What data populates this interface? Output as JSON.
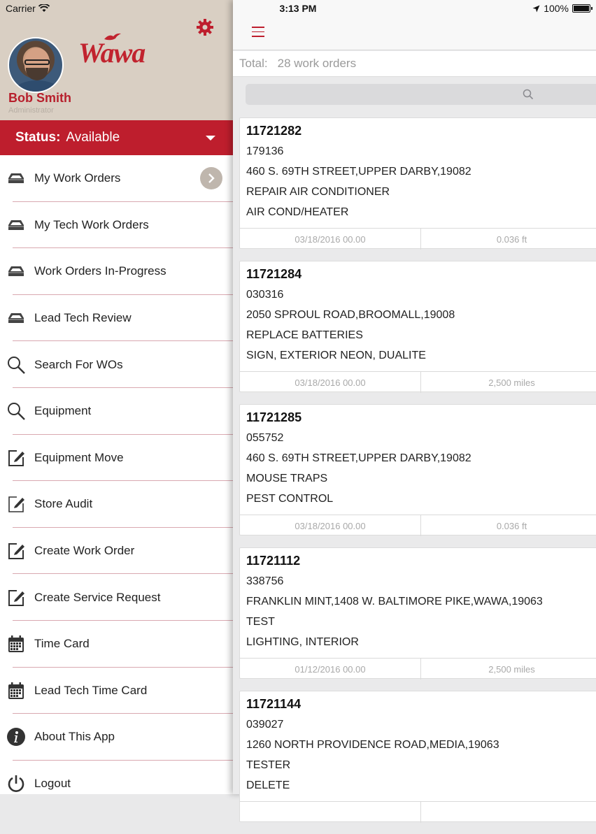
{
  "status_bar": {
    "carrier": "Carrier",
    "time": "3:13 PM",
    "battery": "100%"
  },
  "profile": {
    "logo_text": "Wawa",
    "name": "Bob Smith",
    "role": "Administrator"
  },
  "availability": {
    "label": "Status:",
    "value": "Available"
  },
  "menu": [
    {
      "label": "My Work Orders",
      "icon": "inbox-icon"
    },
    {
      "label": "My Tech Work Orders",
      "icon": "inbox-icon"
    },
    {
      "label": "Work Orders In-Progress",
      "icon": "inbox-icon"
    },
    {
      "label": "Lead Tech Review",
      "icon": "inbox-icon"
    },
    {
      "label": "Search For WOs",
      "icon": "search-icon"
    },
    {
      "label": "Equipment",
      "icon": "search-icon"
    },
    {
      "label": "Equipment Move",
      "icon": "edit-icon"
    },
    {
      "label": "Store Audit",
      "icon": "edit-icon"
    },
    {
      "label": "Create Work Order",
      "icon": "edit-icon"
    },
    {
      "label": "Create Service Request",
      "icon": "edit-icon"
    },
    {
      "label": "Time Card",
      "icon": "calendar-icon"
    },
    {
      "label": "Lead Tech Time Card",
      "icon": "calendar-icon"
    },
    {
      "label": "About This App",
      "icon": "info-icon"
    },
    {
      "label": "Logout",
      "icon": "power-icon"
    }
  ],
  "summary": {
    "total_label": "Total:",
    "total_value": "28 work orders"
  },
  "search": {
    "placeholder": ""
  },
  "work_orders": [
    {
      "number": "11721282",
      "store": "179136",
      "address": "460 S. 69TH STREET,UPPER DARBY,19082",
      "problem": "REPAIR AIR CONDITIONER",
      "equipment": "AIR COND/HEATER",
      "date": "03/18/2016 00.00",
      "distance": "0.036 ft"
    },
    {
      "number": "11721284",
      "store": "030316",
      "address": "2050 SPROUL ROAD,BROOMALL,19008",
      "problem": "REPLACE BATTERIES",
      "equipment": "SIGN, EXTERIOR NEON, DUALITE",
      "date": "03/18/2016 00.00",
      "distance": "2,500 miles"
    },
    {
      "number": "11721285",
      "store": "055752",
      "address": "460 S. 69TH STREET,UPPER DARBY,19082",
      "problem": "MOUSE TRAPS",
      "equipment": "PEST CONTROL",
      "date": "03/18/2016 00.00",
      "distance": "0.036 ft"
    },
    {
      "number": "11721112",
      "store": "338756",
      "address": "FRANKLIN MINT,1408 W. BALTIMORE PIKE,WAWA,19063",
      "problem": "TEST",
      "equipment": "LIGHTING, INTERIOR",
      "date": "01/12/2016 00.00",
      "distance": "2,500 miles"
    },
    {
      "number": "11721144",
      "store": "039027",
      "address": "1260 NORTH PROVIDENCE ROAD,MEDIA,19063",
      "problem": "TESTER",
      "equipment": "DELETE",
      "date": "",
      "distance": ""
    }
  ],
  "colors": {
    "brand_red": "#be1e2d",
    "profile_bg": "#d9cfc3"
  }
}
